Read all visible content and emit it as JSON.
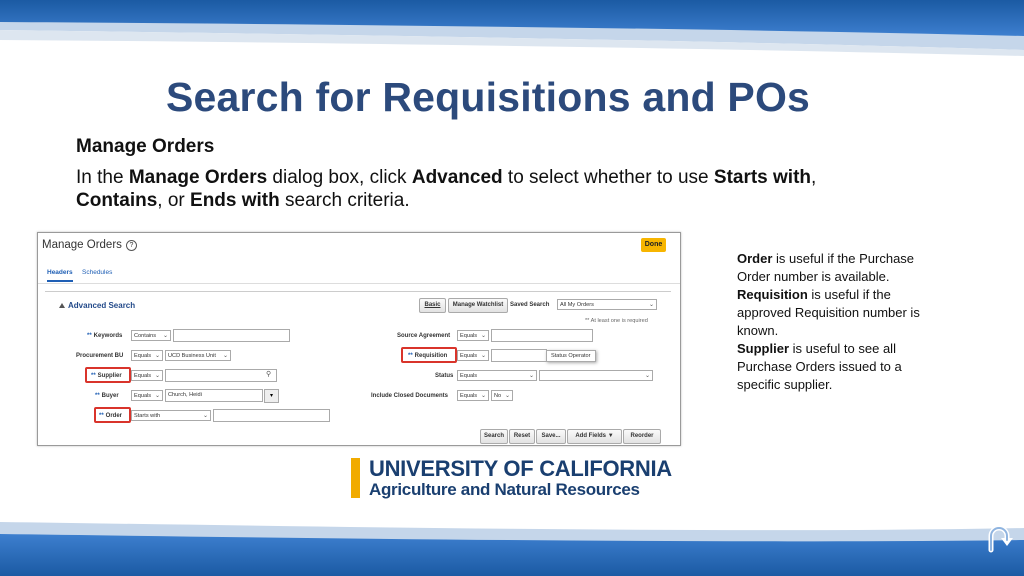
{
  "slide": {
    "title": "Search for Requisitions and POs",
    "subheading": "Manage Orders",
    "instruction": {
      "p1": "In the ",
      "b1": "Manage Orders",
      "p2": " dialog box, click ",
      "b2": "Advanced",
      "p3": " to select whether to use ",
      "b3": "Starts with",
      "p4": ", ",
      "b4": "Contains",
      "p5": ", or ",
      "b5": "Ends with",
      "p6": " search criteria."
    }
  },
  "dialog": {
    "title": "Manage Orders",
    "done_label": "Done",
    "tabs": [
      "Headers",
      "Schedules"
    ],
    "section_label": "Advanced Search",
    "buttons": {
      "basic": "Basic",
      "manage_watchlist": "Manage Watchlist",
      "search": "Search",
      "reset": "Reset",
      "save": "Save...",
      "add_fields": "Add Fields",
      "reorder": "Reorder"
    },
    "saved_search_label": "Saved Search",
    "saved_search_value": "All My Orders",
    "required_note": "** At least one is required",
    "fields": {
      "keywords": {
        "label": "Keywords",
        "operator": "Contains"
      },
      "procurement_bu": {
        "label": "Procurement BU",
        "operator": "Equals",
        "value": "UCD Business Unit"
      },
      "supplier": {
        "label": "Supplier",
        "operator": "Equals"
      },
      "buyer": {
        "label": "Buyer",
        "operator": "Equals",
        "value": "Church, Heidi"
      },
      "order": {
        "label": "Order",
        "operator": "Starts with"
      },
      "source_agreement": {
        "label": "Source Agreement",
        "operator": "Equals"
      },
      "requisition": {
        "label": "Requisition",
        "operator": "Equals"
      },
      "status": {
        "label": "Status",
        "operator": "Equals"
      },
      "include_closed": {
        "label": "Include Closed Documents",
        "operator": "Equals",
        "value": "No"
      }
    },
    "tooltip": "Status Operator",
    "star": "**"
  },
  "notes": [
    {
      "bold": "Order",
      "text": " is useful if the Purchase Order number is available."
    },
    {
      "bold": "Requisition",
      "text": " is useful if the approved Requisition number is known."
    },
    {
      "bold": "Supplier",
      "text": " is useful to see all Purchase Orders issued to a specific supplier."
    }
  ],
  "logo": {
    "line1": "UNIVERSITY OF CALIFORNIA",
    "line2": "Agriculture and Natural Resources"
  },
  "colors": {
    "title": "#2c4a7c",
    "band_dark": "#1d5ea8",
    "band_light": "#b9cde3",
    "logo_bar": "#f1ab00",
    "highlight": "#d9342b"
  },
  "icons": {
    "help": "help-icon",
    "search": "magnifier-icon",
    "nav": "return-arrow-icon"
  }
}
